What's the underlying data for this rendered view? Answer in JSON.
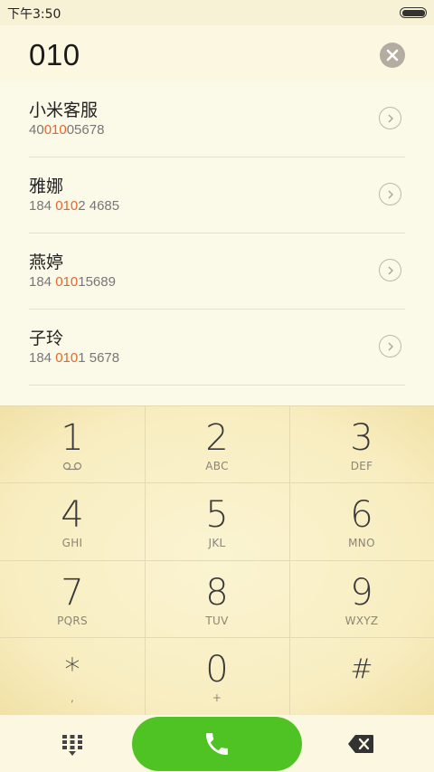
{
  "status_bar": {
    "time": "下午3:50"
  },
  "dialer": {
    "input_value": "010"
  },
  "contacts": [
    {
      "name": "小米客服",
      "number_prefix": "40",
      "number_match": "010",
      "number_suffix": "05678"
    },
    {
      "name": "雅娜",
      "number_prefix": "184 ",
      "number_match": "010",
      "number_suffix": "2 4685"
    },
    {
      "name": "燕婷",
      "number_prefix": "184 ",
      "number_match": "010",
      "number_suffix": "15689"
    },
    {
      "name": "子玲",
      "number_prefix": "184 ",
      "number_match": "010",
      "number_suffix": "1 5678"
    }
  ],
  "keypad": {
    "keys": [
      {
        "digit": "1",
        "letters": ""
      },
      {
        "digit": "2",
        "letters": "ABC"
      },
      {
        "digit": "3",
        "letters": "DEF"
      },
      {
        "digit": "4",
        "letters": "GHI"
      },
      {
        "digit": "5",
        "letters": "JKL"
      },
      {
        "digit": "6",
        "letters": "MNO"
      },
      {
        "digit": "7",
        "letters": "PQRS"
      },
      {
        "digit": "8",
        "letters": "TUV"
      },
      {
        "digit": "9",
        "letters": "WXYZ"
      },
      {
        "digit": "*",
        "letters": ","
      },
      {
        "digit": "0",
        "letters": "+"
      },
      {
        "digit": "#",
        "letters": ""
      }
    ]
  },
  "icons": {
    "clear": "clear-icon",
    "detail": "chevron-right-icon",
    "voicemail": "voicemail-icon",
    "keypad_toggle": "dialpad-icon",
    "call": "phone-icon",
    "backspace": "backspace-icon"
  },
  "colors": {
    "background": "#fbf7e0",
    "highlight": "#e2672b",
    "call_button": "#4fc323",
    "text_primary": "#222222",
    "text_secondary": "#777777"
  }
}
